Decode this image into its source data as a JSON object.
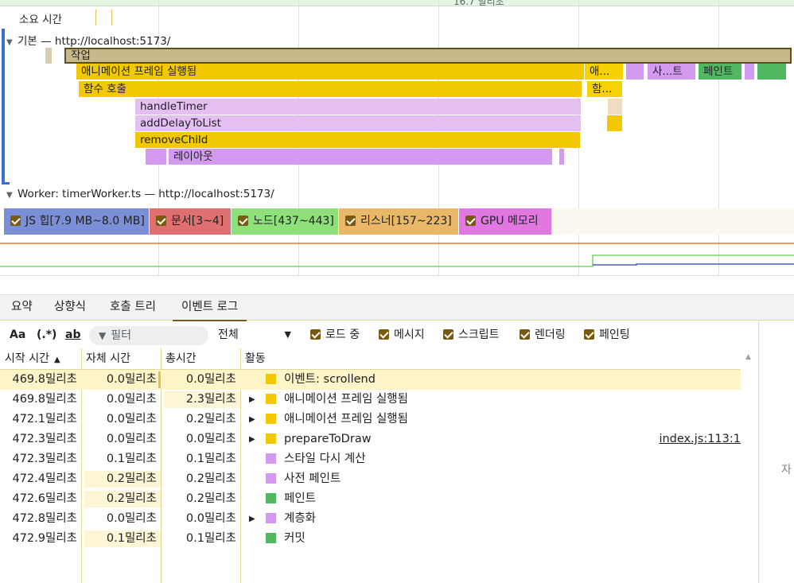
{
  "timeline": {
    "duration_label": "소요 시간",
    "top_cut_label": "16.7 밀리초",
    "main_track": "기본 — http://localhost:5173/",
    "worker_track": "Worker: timerWorker.ts — http://localhost:5173/",
    "flame": {
      "task": "작업",
      "animation_frame": "애니메이션 프레임 실행됨",
      "animation_frame_short": "애...",
      "shortcut_short": "사...트",
      "paint": "페인트",
      "function_call": "함수 호출",
      "function_call_short": "함...",
      "handle_timer": "handleTimer",
      "add_delay": "addDelayToList",
      "remove_child": "removeChild",
      "layout": "레이아웃"
    }
  },
  "counters": [
    {
      "label": "JS 힙[7.9 MB~8.0 MB]",
      "color": "#7b8fd6"
    },
    {
      "label": "문서[3~4]",
      "color": "#e07070"
    },
    {
      "label": "노드[437~443]",
      "color": "#8ee07a"
    },
    {
      "label": "리스너[157~223]",
      "color": "#e8b868"
    },
    {
      "label": "GPU 메모리",
      "color": "#e078e0"
    }
  ],
  "tabs": [
    "요약",
    "상향식",
    "호출 트리",
    "이벤트 로그"
  ],
  "toolbar": {
    "match_case": "Aa",
    "regex": "(.*)",
    "whole_word": "ab",
    "filter_placeholder": "필터",
    "scope": "전체",
    "checks": [
      "로드 중",
      "메시지",
      "스크립트",
      "렌더링",
      "페인팅"
    ]
  },
  "table": {
    "headers": [
      "시작 시간",
      "자체 시간",
      "총시간",
      "활동"
    ],
    "rows": [
      {
        "start": "469.8밀리초",
        "self": "0.0밀리초",
        "total": "0.0밀리초",
        "activity": "이벤트: scrollend",
        "color": "#f2c800",
        "expand": false,
        "link": ""
      },
      {
        "start": "469.8밀리초",
        "self": "0.0밀리초",
        "total": "2.3밀리초",
        "activity": "애니메이션 프레임 실행됨",
        "color": "#f2c800",
        "expand": true,
        "link": ""
      },
      {
        "start": "472.1밀리초",
        "self": "0.0밀리초",
        "total": "0.2밀리초",
        "activity": "애니메이션 프레임 실행됨",
        "color": "#f2c800",
        "expand": true,
        "link": ""
      },
      {
        "start": "472.3밀리초",
        "self": "0.0밀리초",
        "total": "0.0밀리초",
        "activity": "prepareToDraw",
        "color": "#f2c800",
        "expand": true,
        "link": "index.js:113:1"
      },
      {
        "start": "472.3밀리초",
        "self": "0.1밀리초",
        "total": "0.1밀리초",
        "activity": "스타일 다시 계산",
        "color": "#d39af0",
        "expand": false,
        "link": ""
      },
      {
        "start": "472.4밀리초",
        "self": "0.2밀리초",
        "total": "0.2밀리초",
        "activity": "사전 페인트",
        "color": "#d39af0",
        "expand": false,
        "link": ""
      },
      {
        "start": "472.6밀리초",
        "self": "0.2밀리초",
        "total": "0.2밀리초",
        "activity": "페인트",
        "color": "#50b860",
        "expand": false,
        "link": ""
      },
      {
        "start": "472.8밀리초",
        "self": "0.0밀리초",
        "total": "0.0밀리초",
        "activity": "계층화",
        "color": "#d39af0",
        "expand": true,
        "link": ""
      },
      {
        "start": "472.9밀리초",
        "self": "0.1밀리초",
        "total": "0.1밀리초",
        "activity": "커밋",
        "color": "#50b860",
        "expand": false,
        "link": ""
      }
    ]
  },
  "right_pane_text": "자"
}
